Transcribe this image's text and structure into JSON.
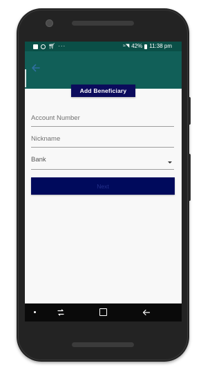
{
  "status_bar": {
    "battery": "42%",
    "time": "11:38 pm",
    "signal_text": "≈◥"
  },
  "header": {
    "title": "Add Beneficiary"
  },
  "form": {
    "account_number_placeholder": "Account Number",
    "nickname_placeholder": "Nickname",
    "bank_label": "Bank",
    "next_label": "Next"
  },
  "colors": {
    "app_bar": "#115f58",
    "status_bar": "#0a4f47",
    "primary_button": "#000a5c",
    "title_badge": "#0b0b5c"
  },
  "icons": {
    "back": "arrow-left-icon",
    "dropdown": "chevron-down-icon",
    "nav_back": "nav-back-icon",
    "nav_home": "nav-square-icon",
    "nav_recent": "nav-recent-icon"
  }
}
